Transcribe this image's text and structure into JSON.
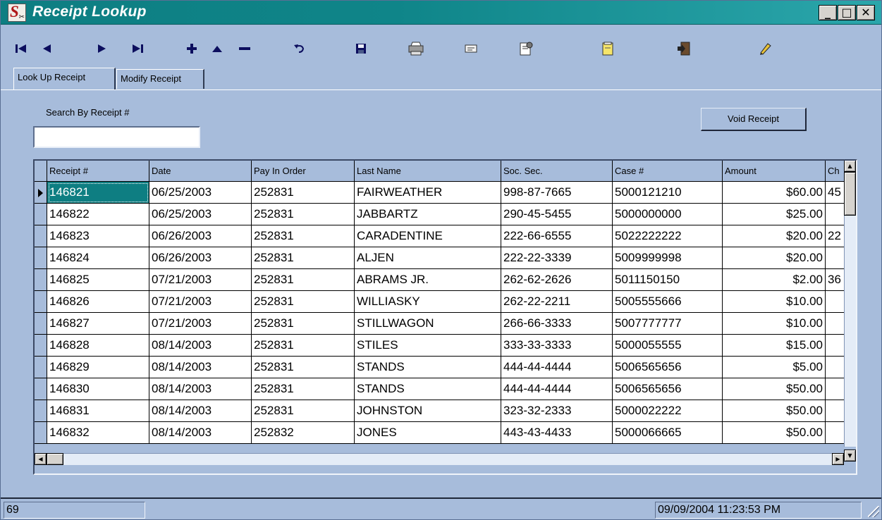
{
  "window": {
    "title": "Receipt Lookup",
    "minimize_glyph": "_",
    "maximize_glyph": "□",
    "close_glyph": "✕"
  },
  "toolbar": {
    "buttons": [
      {
        "name": "first-record",
        "icon": "skip-first-icon"
      },
      {
        "name": "previous-record",
        "icon": "triangle-left-icon"
      },
      {
        "name": "next-record",
        "icon": "triangle-right-icon"
      },
      {
        "name": "last-record",
        "icon": "skip-last-icon"
      },
      {
        "name": "add-record",
        "icon": "plus-icon"
      },
      {
        "name": "edit-record",
        "icon": "triangle-up-icon"
      },
      {
        "name": "delete-record",
        "icon": "minus-icon"
      },
      {
        "name": "undo",
        "icon": "undo-icon"
      },
      {
        "name": "save",
        "icon": "floppy-disk-icon"
      },
      {
        "name": "print",
        "icon": "printer-icon"
      },
      {
        "name": "email",
        "icon": "envelope-icon"
      },
      {
        "name": "properties",
        "icon": "document-settings-icon"
      },
      {
        "name": "notes",
        "icon": "notepad-icon"
      },
      {
        "name": "exit",
        "icon": "exit-door-icon"
      },
      {
        "name": "edit-pen",
        "icon": "pencil-icon"
      }
    ]
  },
  "tabs": [
    {
      "label": "Look Up Receipt",
      "active": true
    },
    {
      "label": "Modify Receipt",
      "active": false
    }
  ],
  "search": {
    "label": "Search By Receipt #",
    "value": ""
  },
  "void_button": {
    "label": "Void Receipt"
  },
  "grid": {
    "columns": [
      "Receipt #",
      "Date",
      "Pay In Order",
      "Last Name",
      "Soc. Sec.",
      "Case #",
      "Amount",
      "Ch"
    ],
    "rows": [
      [
        "146821",
        "06/25/2003",
        "252831",
        "FAIRWEATHER",
        "998-87-7665",
        "5000121210",
        "$60.00",
        "45"
      ],
      [
        "146822",
        "06/25/2003",
        "252831",
        "JABBARTZ",
        "290-45-5455",
        "5000000000",
        "$25.00",
        ""
      ],
      [
        "146823",
        "06/26/2003",
        "252831",
        "CARADENTINE",
        "222-66-6555",
        "5022222222",
        "$20.00",
        "22"
      ],
      [
        "146824",
        "06/26/2003",
        "252831",
        "ALJEN",
        "222-22-3339",
        "5009999998",
        "$20.00",
        ""
      ],
      [
        "146825",
        "07/21/2003",
        "252831",
        "ABRAMS JR.",
        "262-62-2626",
        "5011150150",
        "$2.00",
        "36"
      ],
      [
        "146826",
        "07/21/2003",
        "252831",
        "WILLIASKY",
        "262-22-2211",
        "5005555666",
        "$10.00",
        ""
      ],
      [
        "146827",
        "07/21/2003",
        "252831",
        "STILLWAGON",
        "266-66-3333",
        "5007777777",
        "$10.00",
        ""
      ],
      [
        "146828",
        "08/14/2003",
        "252831",
        "STILES",
        "333-33-3333",
        "5000055555",
        "$15.00",
        ""
      ],
      [
        "146829",
        "08/14/2003",
        "252831",
        "STANDS",
        "444-44-4444",
        "5006565656",
        "$5.00",
        ""
      ],
      [
        "146830",
        "08/14/2003",
        "252831",
        "STANDS",
        "444-44-4444",
        "5006565656",
        "$50.00",
        ""
      ],
      [
        "146831",
        "08/14/2003",
        "252831",
        "JOHNSTON",
        "323-32-2333",
        "5000022222",
        "$50.00",
        ""
      ],
      [
        "146832",
        "08/14/2003",
        "252832",
        "JONES",
        "443-43-4433",
        "5000066665",
        "$50.00",
        ""
      ]
    ],
    "current_row": 0
  },
  "statusbar": {
    "record_count": "69",
    "datetime": "09/09/2004 11:23:53 PM"
  }
}
